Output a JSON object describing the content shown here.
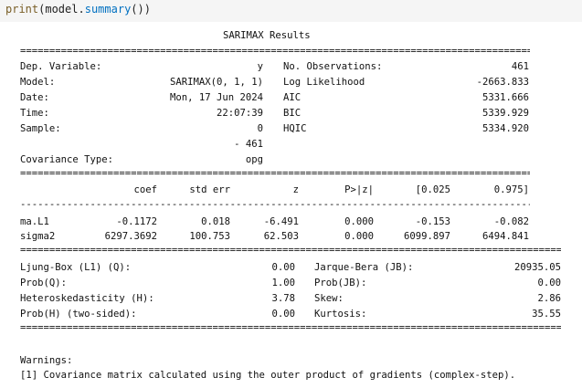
{
  "code": {
    "func": "print",
    "obj": "model",
    "attr": "summary",
    "tail": "()"
  },
  "summary": {
    "title": "SARIMAX Results",
    "info_left": [
      {
        "label": "Dep. Variable:",
        "value": "y"
      },
      {
        "label": "Model:",
        "value": "SARIMAX(0, 1, 1)"
      },
      {
        "label": "Date:",
        "value": "Mon, 17 Jun 2024"
      },
      {
        "label": "Time:",
        "value": "22:07:39"
      },
      {
        "label": "Sample:",
        "value": "0"
      },
      {
        "label": "",
        "value": "- 461"
      },
      {
        "label": "Covariance Type:",
        "value": "opg"
      }
    ],
    "info_right": [
      {
        "label": "No. Observations:",
        "value": "461"
      },
      {
        "label": "Log Likelihood",
        "value": "-2663.833"
      },
      {
        "label": "AIC",
        "value": "5331.666"
      },
      {
        "label": "BIC",
        "value": "5339.929"
      },
      {
        "label": "HQIC",
        "value": "5334.920"
      }
    ],
    "coef_headers": [
      "coef",
      "std err",
      "z",
      "P>|z|",
      "[0.025",
      "0.975]"
    ],
    "coef_rows": [
      {
        "name": "ma.L1",
        "cells": [
          "-0.1172",
          "0.018",
          "-6.491",
          "0.000",
          "-0.153",
          "-0.082"
        ]
      },
      {
        "name": "sigma2",
        "cells": [
          "6297.3692",
          "100.753",
          "62.503",
          "0.000",
          "6099.897",
          "6494.841"
        ]
      }
    ],
    "diag_left": [
      {
        "label": "Ljung-Box (L1) (Q):",
        "value": "0.00"
      },
      {
        "label": "Prob(Q):",
        "value": "1.00"
      },
      {
        "label": "Heteroskedasticity (H):",
        "value": "3.78"
      },
      {
        "label": "Prob(H) (two-sided):",
        "value": "0.00"
      }
    ],
    "diag_right": [
      {
        "label": "Jarque-Bera (JB):",
        "value": "20935.05"
      },
      {
        "label": "Prob(JB):",
        "value": "0.00"
      },
      {
        "label": "Skew:",
        "value": "2.86"
      },
      {
        "label": "Kurtosis:",
        "value": "35.55"
      }
    ],
    "warnings_title": "Warnings:",
    "warning_1": "[1] Covariance matrix calculated using the outer product of gradients (complex-step)."
  }
}
